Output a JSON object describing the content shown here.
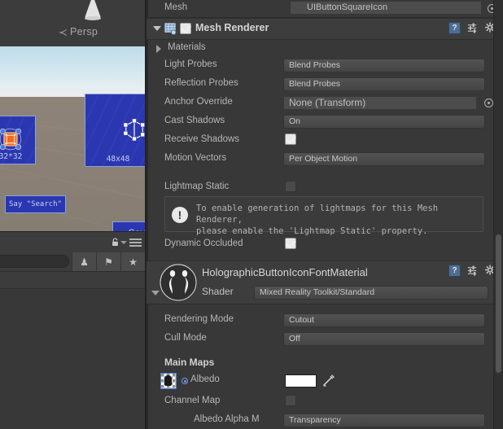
{
  "scene": {
    "gizmo": {
      "label": "Persp",
      "arrow": "≺",
      "cone_name": "view-cone"
    },
    "buttons": [
      {
        "caption": "32*32"
      },
      {
        "caption": "48x48"
      }
    ],
    "say_buttons": [
      {
        "label": "Say \"Search\""
      },
      {
        "label": "Say"
      }
    ]
  },
  "hierarchy_toolbar": {
    "lock_icon": "lock-icon",
    "menu_icon": "hamburger-menu-icon",
    "search_placeholder": "",
    "filters": [
      {
        "icon": "avatar-filter-icon",
        "glyph": "♟"
      },
      {
        "icon": "tag-filter-icon",
        "glyph": "⚑"
      },
      {
        "icon": "favorite-filter-icon",
        "glyph": "★"
      }
    ]
  },
  "inspector": {
    "mesh_row": {
      "label": "Mesh",
      "value": "UIButtonSquareIcon",
      "picker": "object-picker-icon"
    },
    "mesh_renderer": {
      "title": "Mesh Renderer",
      "enabled": true,
      "icons": {
        "help": "?",
        "preset": "preset-icon",
        "gear": "gear-icon"
      },
      "materials_label": "Materials",
      "rows": [
        {
          "label": "Light Probes",
          "value": "Blend Probes",
          "kind": "popup"
        },
        {
          "label": "Reflection Probes",
          "value": "Blend Probes",
          "kind": "popup"
        },
        {
          "label": "Anchor Override",
          "value": "None (Transform)",
          "kind": "object"
        },
        {
          "label": "Cast Shadows",
          "value": "On",
          "kind": "popup"
        },
        {
          "label": "Receive Shadows",
          "value": true,
          "kind": "toggle"
        },
        {
          "label": "Motion Vectors",
          "value": "Per Object Motion",
          "kind": "popup"
        }
      ],
      "lightmap_static": {
        "label": "Lightmap Static",
        "value": false
      },
      "helpbox": {
        "icon": "warning-icon",
        "glyph": "!",
        "line1": "To enable generation of lightmaps for this Mesh Renderer,",
        "line2": "please enable the 'Lightmap Static' property."
      },
      "dynamic_occluded": {
        "label": "Dynamic Occluded",
        "value": true
      }
    },
    "material": {
      "name": "HolographicButtonIconFontMaterial",
      "shader_label": "Shader",
      "shader_value": "Mixed Reality Toolkit/Standard",
      "icons": {
        "help": "?",
        "preset": "preset-icon",
        "gear": "gear-icon"
      },
      "rows": [
        {
          "label": "Rendering Mode",
          "value": "Cutout",
          "kind": "popup"
        },
        {
          "label": "Cull Mode",
          "value": "Off",
          "kind": "popup"
        }
      ],
      "main_maps_title": "Main Maps",
      "albedo": {
        "label": "Albedo",
        "texture_thumb": "texture-thumbnail",
        "color": "#FFFFFF",
        "eyedropper": "eyedropper-icon"
      },
      "channel_map": {
        "label": "Channel Map",
        "value": false
      },
      "albedo_alpha": {
        "label": "Albedo Alpha M",
        "value": "Transparency",
        "kind": "popup"
      }
    }
  },
  "colors": {
    "panel_bg": "#383838",
    "header_bg": "#3D3D3D",
    "field_bg": "#4B4B4B",
    "accent_blue": "#2B37B0",
    "selection_blue": "#4B7FE0"
  }
}
